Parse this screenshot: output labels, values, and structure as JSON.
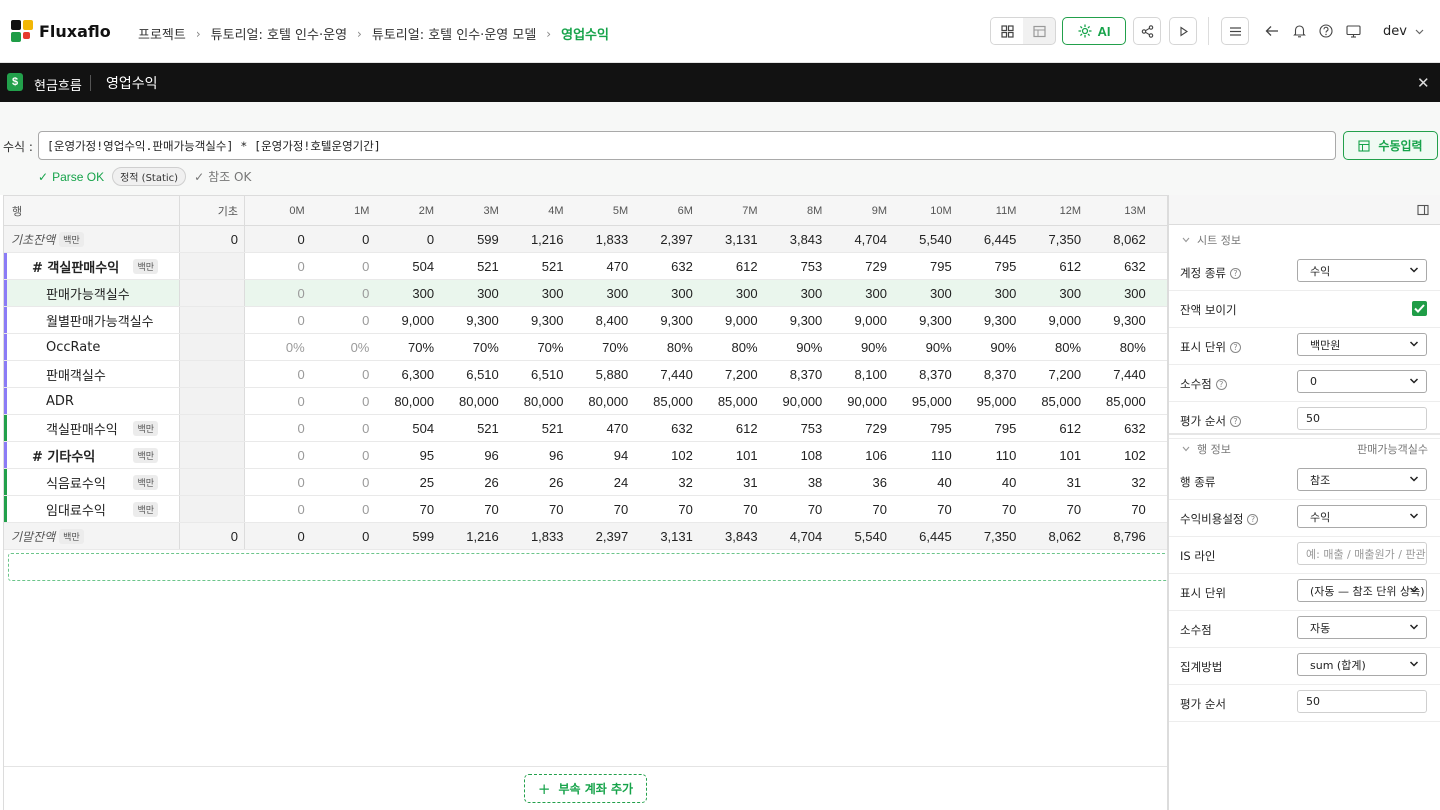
{
  "app": {
    "name": "Fluxaflo",
    "colors": {
      "accent": "#16a34a",
      "logo": [
        "#1f9d47",
        "#f2b705",
        "#e63b2e",
        "#111111"
      ]
    }
  },
  "breadcrumb": [
    "프로젝트",
    "튜토리얼: 호텔 인수·운영",
    "튜토리얼: 호텔 인수·운영 모델",
    "영업수익"
  ],
  "toolbar": {
    "ai_label": "AI",
    "user": "dev"
  },
  "sheet_bar": {
    "badge": "$",
    "category": "현금흐름",
    "title": "영업수익"
  },
  "formula": {
    "label": "수식 :",
    "value": "[운영가정!영업수익.판매가능객실수] * [운영가정!호텔운영기간]",
    "manual_button": "수동입력",
    "parse_status": "Parse OK",
    "type_pill": "정적 (Static)",
    "ref_status": "참조 OK"
  },
  "grid": {
    "row_header": "행",
    "base_header": "기초",
    "months": [
      "0M",
      "1M",
      "2M",
      "3M",
      "4M",
      "5M",
      "6M",
      "7M",
      "8M",
      "9M",
      "10M",
      "11M",
      "12M",
      "13M"
    ],
    "rows": [
      {
        "name": "기초잔액",
        "unit": "백만",
        "base": "0",
        "values": [
          "0",
          "0",
          "0",
          "599",
          "1,216",
          "1,833",
          "2,397",
          "3,131",
          "3,843",
          "4,704",
          "5,540",
          "6,445",
          "7,350",
          "8,062"
        ]
      },
      {
        "name": "# 객실판매수익",
        "unit": "백만",
        "base": "",
        "values": [
          "0",
          "0",
          "504",
          "521",
          "521",
          "470",
          "632",
          "612",
          "753",
          "729",
          "795",
          "795",
          "612",
          "632"
        ]
      },
      {
        "name": "판매가능객실수",
        "unit": "",
        "base": "",
        "values": [
          "0",
          "0",
          "300",
          "300",
          "300",
          "300",
          "300",
          "300",
          "300",
          "300",
          "300",
          "300",
          "300",
          "300"
        ]
      },
      {
        "name": "월별판매가능객실수",
        "unit": "",
        "base": "",
        "values": [
          "0",
          "0",
          "9,000",
          "9,300",
          "9,300",
          "8,400",
          "9,300",
          "9,000",
          "9,300",
          "9,000",
          "9,300",
          "9,300",
          "9,000",
          "9,300"
        ]
      },
      {
        "name": "OccRate",
        "unit": "",
        "base": "",
        "values": [
          "0%",
          "0%",
          "70%",
          "70%",
          "70%",
          "70%",
          "80%",
          "80%",
          "90%",
          "90%",
          "90%",
          "90%",
          "80%",
          "80%"
        ]
      },
      {
        "name": "판매객실수",
        "unit": "",
        "base": "",
        "values": [
          "0",
          "0",
          "6,300",
          "6,510",
          "6,510",
          "5,880",
          "7,440",
          "7,200",
          "8,370",
          "8,100",
          "8,370",
          "8,370",
          "7,200",
          "7,440"
        ]
      },
      {
        "name": "ADR",
        "unit": "",
        "base": "",
        "values": [
          "0",
          "0",
          "80,000",
          "80,000",
          "80,000",
          "80,000",
          "85,000",
          "85,000",
          "90,000",
          "90,000",
          "95,000",
          "95,000",
          "85,000",
          "85,000"
        ]
      },
      {
        "name": "객실판매수익",
        "unit": "백만",
        "base": "",
        "values": [
          "0",
          "0",
          "504",
          "521",
          "521",
          "470",
          "632",
          "612",
          "753",
          "729",
          "795",
          "795",
          "612",
          "632"
        ]
      },
      {
        "name": "# 기타수익",
        "unit": "백만",
        "base": "",
        "values": [
          "0",
          "0",
          "95",
          "96",
          "96",
          "94",
          "102",
          "101",
          "108",
          "106",
          "110",
          "110",
          "101",
          "102"
        ]
      },
      {
        "name": "식음료수익",
        "unit": "백만",
        "base": "",
        "values": [
          "0",
          "0",
          "25",
          "26",
          "26",
          "24",
          "32",
          "31",
          "38",
          "36",
          "40",
          "40",
          "31",
          "32"
        ]
      },
      {
        "name": "임대료수익",
        "unit": "백만",
        "base": "",
        "values": [
          "0",
          "0",
          "70",
          "70",
          "70",
          "70",
          "70",
          "70",
          "70",
          "70",
          "70",
          "70",
          "70",
          "70"
        ]
      },
      {
        "name": "기말잔액",
        "unit": "백만",
        "base": "0",
        "values": [
          "0",
          "0",
          "599",
          "1,216",
          "1,833",
          "2,397",
          "3,131",
          "3,843",
          "4,704",
          "5,540",
          "6,445",
          "7,350",
          "8,062",
          "8,796"
        ]
      }
    ],
    "add_button": "부속 계좌 추가"
  },
  "panel": {
    "sheet_section": "시트 정보",
    "sheet_props": [
      {
        "label": "계정 종류",
        "value": "수익",
        "kind": "select",
        "help": true
      },
      {
        "label": "잔액 보이기",
        "value": "",
        "kind": "check",
        "help": false
      },
      {
        "label": "표시 단위",
        "value": "백만원",
        "kind": "select",
        "help": true
      },
      {
        "label": "소수점",
        "value": "0",
        "kind": "select",
        "help": true
      },
      {
        "label": "평가 순서",
        "value": "50",
        "kind": "input",
        "help": true
      }
    ],
    "row_section": "행 정보",
    "row_section_target": "판매가능객실수",
    "row_props": [
      {
        "label": "행 종류",
        "value": "참조",
        "kind": "select",
        "help": false
      },
      {
        "label": "수익비용설정",
        "value": "수익",
        "kind": "select",
        "help": true
      },
      {
        "label": "IS 라인",
        "value": "예: 매출 / 매출원가 / 판관비",
        "kind": "placeholder",
        "help": false
      },
      {
        "label": "표시 단위",
        "value": "(자동 — 참조 단위 상속)",
        "kind": "select",
        "help": false
      },
      {
        "label": "소수점",
        "value": "자동",
        "kind": "select",
        "help": false
      },
      {
        "label": "집계방법",
        "value": "sum (합계)",
        "kind": "select",
        "help": false
      },
      {
        "label": "평가 순서",
        "value": "50",
        "kind": "input",
        "help": false
      }
    ]
  }
}
